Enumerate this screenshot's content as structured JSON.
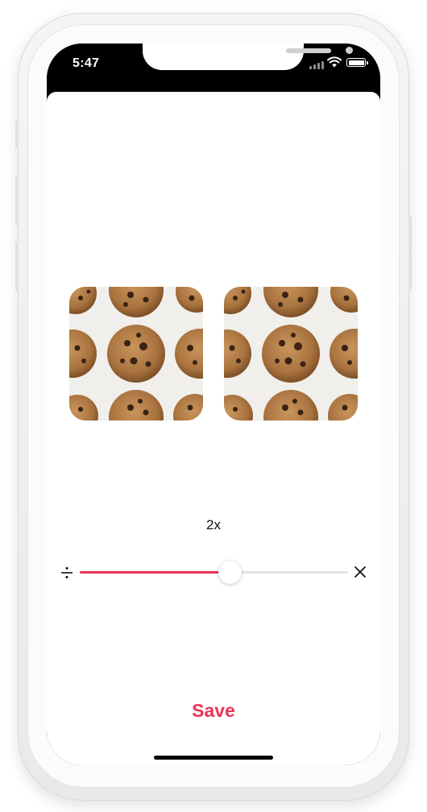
{
  "status_bar": {
    "time": "5:47"
  },
  "photo": {
    "left_image_icon": "cookie-photo",
    "right_image_icon": "cookie-photo"
  },
  "scale": {
    "label": "2x",
    "value": 2,
    "fraction": 0.56,
    "min_icon": "divide-icon",
    "max_icon": "multiply-icon"
  },
  "actions": {
    "save_label": "Save"
  },
  "colors": {
    "accent": "#ec3357",
    "track": "#e3e3e3",
    "background": "#ffffff"
  }
}
